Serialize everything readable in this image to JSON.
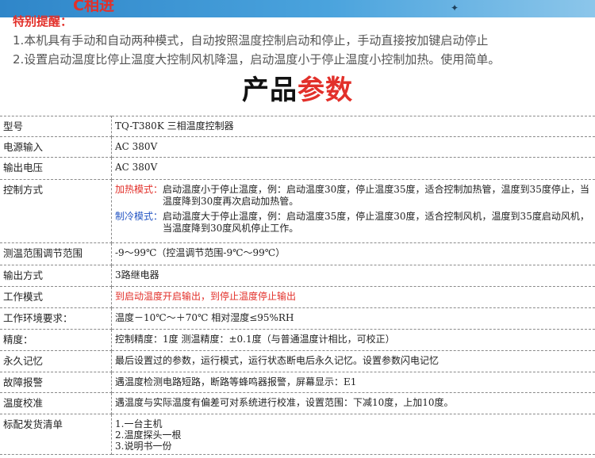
{
  "banner": {
    "fragment": "C相进"
  },
  "notice": {
    "title": "特别提醒：",
    "lines": [
      "1.本机具有手动和自动两种模式，自动按照温度控制启动和停止，手动直接按加键启动停止",
      "2.设置启动温度比停止温度大控制风机降温，启动温度小于停止温度小控制加热。使用简单。"
    ]
  },
  "section_title": {
    "part1": "产品",
    "part2": "参数"
  },
  "params": {
    "model": {
      "label": "型号",
      "value": "TQ-T380K 三相温度控制器"
    },
    "power_input": {
      "label": "电源输入",
      "value": "AC 380V"
    },
    "output_voltage": {
      "label": "输出电压",
      "value": "AC 380V"
    },
    "control_mode": {
      "label": "控制方式",
      "heating_label": "加热模式：",
      "heating_desc": "启动温度小于停止温度，例：启动温度30度，停止温度35度，适合控制加热管，温度到35度停止，当温度降到30度再次启动加热管。",
      "cooling_label": "制冷模式：",
      "cooling_desc": "启动温度大于停止温度，例：启动温度35度，停止温度30度，适合控制风机，温度到35度启动风机，当温度降到30度风机停止工作。"
    },
    "range": {
      "label": "测温范围调节范围",
      "value": "-9～99℃（控温调节范围-9℃～99℃）"
    },
    "output_mode": {
      "label": "输出方式",
      "value": "3路继电器"
    },
    "work_mode": {
      "label": "工作模式",
      "value": "到启动温度开启输出，到停止温度停止输出"
    },
    "environment": {
      "label": "工作环境要求：",
      "value": "温度－10℃～＋70℃ 相对湿度≤95%RH"
    },
    "precision": {
      "label": "精度：",
      "value": "控制精度：1度     测温精度：±0.1度（与普通温度计相比，可校正）"
    },
    "memory": {
      "label": "永久记忆",
      "value": "最后设置过的参数，运行模式，运行状态断电后永久记忆。设置参数闪电记忆"
    },
    "alarm": {
      "label": "故障报警",
      "value": "遇温度检测电路短路，断路等蜂鸣器报警，屏幕显示：E1"
    },
    "calibration": {
      "label": "温度校准",
      "value": "遇温度与实际温度有偏差可对系统进行校准，设置范围：下减10度，上加10度。"
    },
    "package": {
      "label": "标配发货清单",
      "items": [
        "1.一台主机",
        "2.温度探头一根",
        "3.说明书一份"
      ]
    }
  },
  "colors": {
    "accent_red": "#e2302a",
    "accent_blue": "#2455c3",
    "banner_blue": "#2f86c9"
  }
}
